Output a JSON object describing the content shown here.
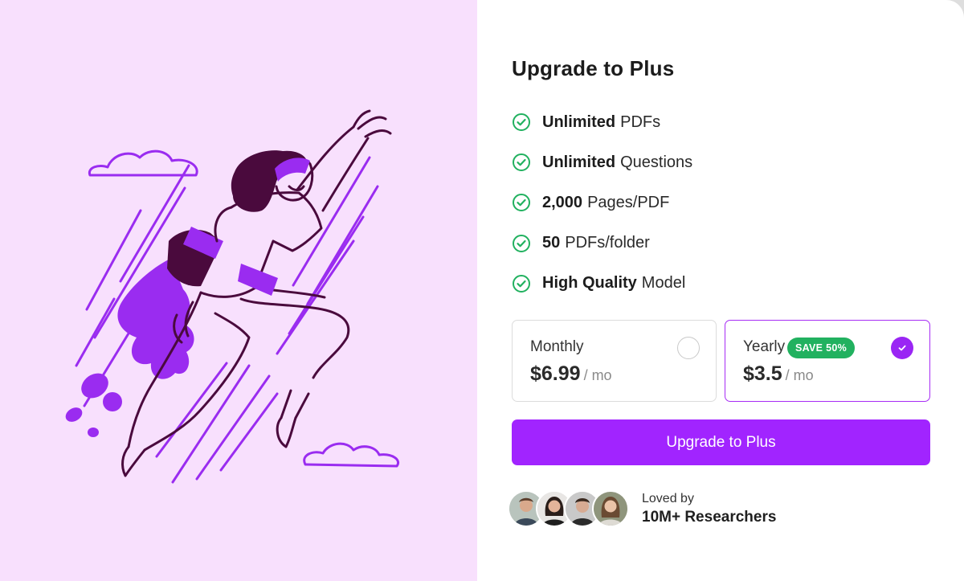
{
  "title": "Upgrade to Plus",
  "features": [
    {
      "bold": "Unlimited",
      "text": "PDFs"
    },
    {
      "bold": "Unlimited",
      "text": "Questions"
    },
    {
      "bold": "2,000",
      "text": "Pages/PDF"
    },
    {
      "bold": "50",
      "text": "PDFs/folder"
    },
    {
      "bold": "High Quality",
      "text": "Model"
    }
  ],
  "plans": {
    "monthly": {
      "name": "Monthly",
      "price": "$6.99",
      "per": "/ mo",
      "selected": false
    },
    "yearly": {
      "name": "Yearly",
      "badge": "SAVE 50%",
      "price": "$3.5",
      "per": "/ mo",
      "selected": true
    }
  },
  "cta_label": "Upgrade to Plus",
  "social": {
    "line1": "Loved by",
    "line2": "10M+ Researchers"
  },
  "colors": {
    "accent": "#a124ff",
    "hero_bg": "#f8e0fd",
    "check_green": "#21b15f",
    "illustration_purple": "#9a2cf0",
    "illustration_dark": "#4a0a3d"
  }
}
